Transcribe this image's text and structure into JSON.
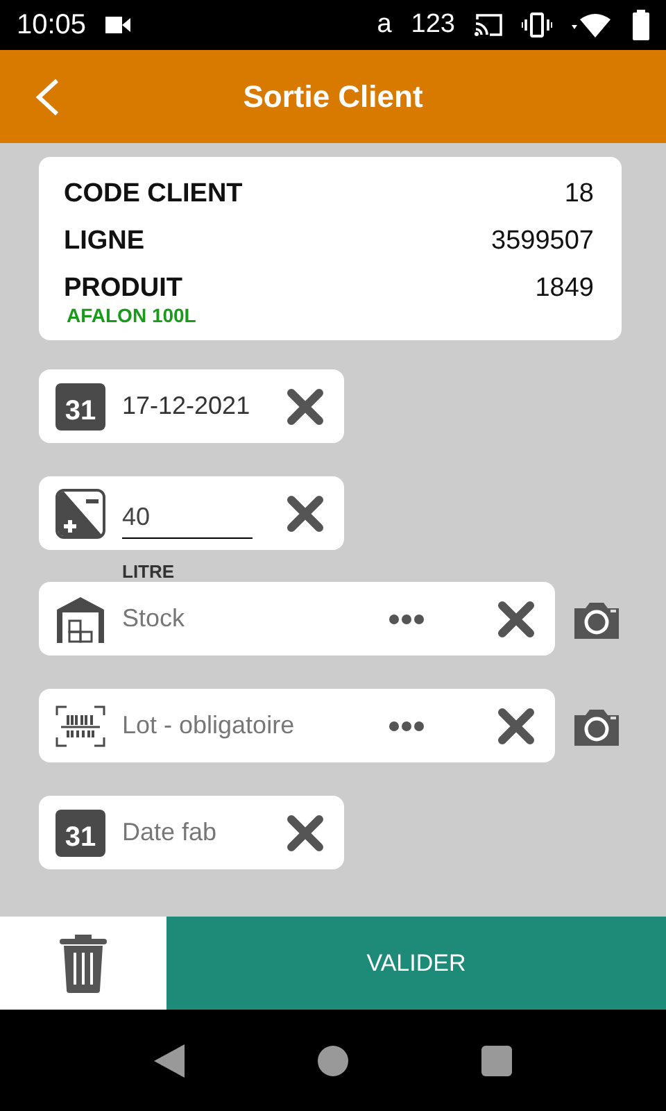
{
  "status_bar": {
    "time": "10:05",
    "indicators": [
      "a",
      "123"
    ]
  },
  "header": {
    "title": "Sortie Client"
  },
  "info": {
    "rows": [
      {
        "label": "CODE CLIENT",
        "value": "18"
      },
      {
        "label": "LIGNE",
        "value": "3599507"
      },
      {
        "label": "PRODUIT",
        "value": "1849"
      }
    ],
    "product_name": "AFALON 100L"
  },
  "fields": [
    {
      "kind": "date",
      "icon_label": "31",
      "value": "17-12-2021"
    },
    {
      "kind": "quantity",
      "value": "40",
      "unit": "LITRE"
    },
    {
      "kind": "warehouse",
      "placeholder": "Stock"
    },
    {
      "kind": "barcode",
      "placeholder": "Lot - obligatoire"
    },
    {
      "kind": "date",
      "icon_label": "31",
      "placeholder": "Date fab"
    }
  ],
  "footer": {
    "button": "VALIDER"
  }
}
